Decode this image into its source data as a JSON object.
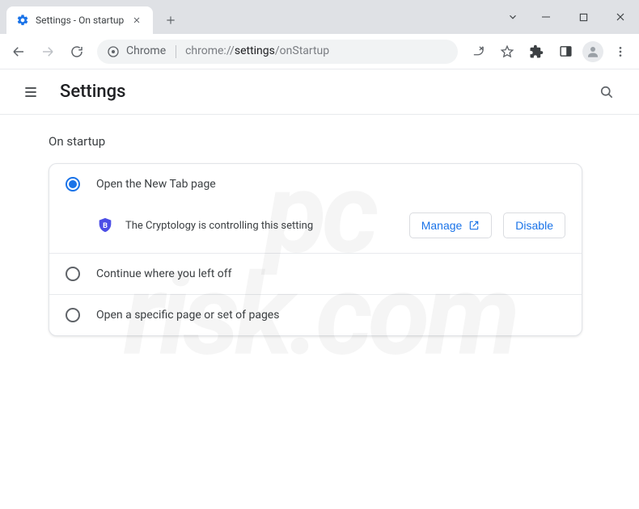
{
  "window": {
    "tab_title": "Settings - On startup"
  },
  "omnibox": {
    "prefix": "Chrome",
    "url_base": "chrome://",
    "url_mid": "settings",
    "url_tail": "/onStartup"
  },
  "header": {
    "title": "Settings"
  },
  "section": {
    "title": "On startup"
  },
  "startup": {
    "options": [
      {
        "label": "Open the New Tab page",
        "selected": true
      },
      {
        "label": "Continue where you left off",
        "selected": false
      },
      {
        "label": "Open a specific page or set of pages",
        "selected": false
      }
    ],
    "extension_notice": "The Cryptology is controlling this setting",
    "manage_label": "Manage",
    "disable_label": "Disable"
  }
}
